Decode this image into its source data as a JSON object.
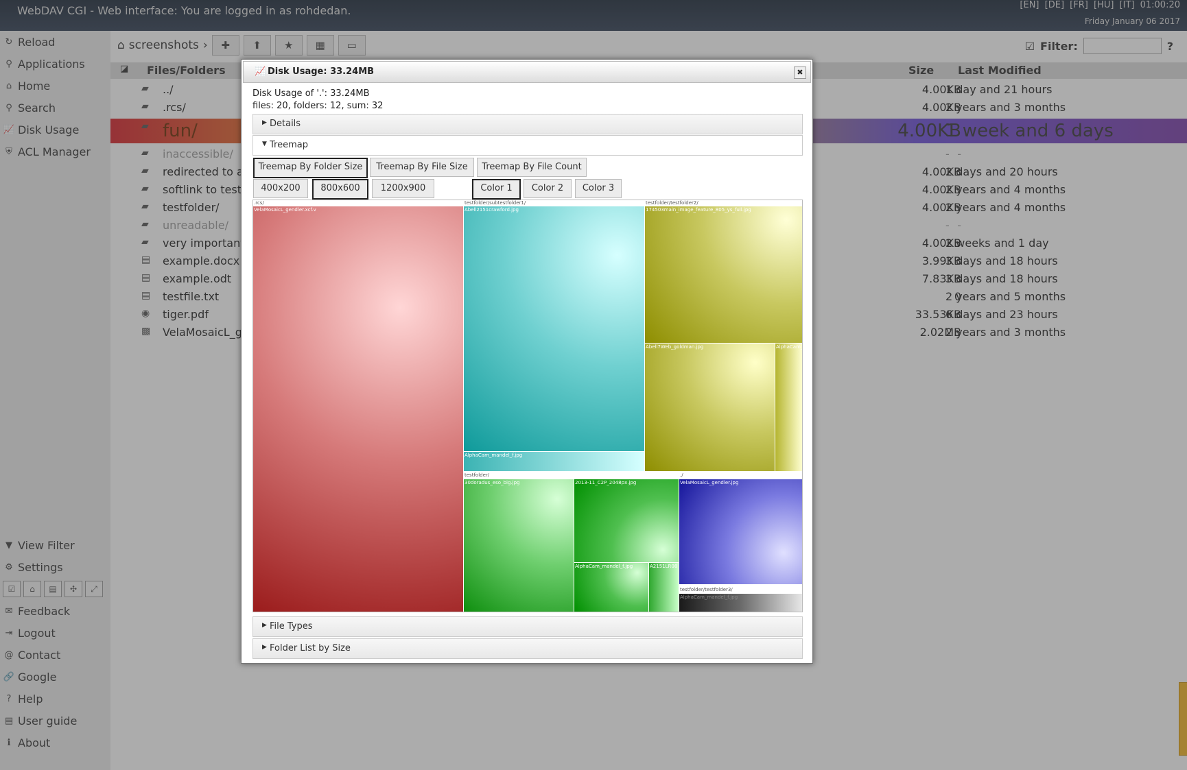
{
  "app": {
    "title": "WebDAV CGI - Web interface: You are logged in as rohdedan.",
    "languages": [
      "[EN]",
      "[DE]",
      "[FR]",
      "[HU]",
      "[IT]"
    ],
    "time": "01:00:20",
    "date": "Friday January 06 2017"
  },
  "sidebar": {
    "items": [
      {
        "label": "Reload",
        "icon": "reload-icon",
        "glyph": "↻"
      },
      {
        "label": "Applications",
        "icon": "applications-icon",
        "glyph": "⚲"
      },
      {
        "label": "Home",
        "icon": "home-icon",
        "glyph": "⌂"
      },
      {
        "label": "Search",
        "icon": "search-icon",
        "glyph": "⚲"
      },
      {
        "label": "Disk Usage",
        "icon": "chart-icon",
        "glyph": "📈"
      },
      {
        "label": "ACL Manager",
        "icon": "shield-icon",
        "glyph": "⛨"
      }
    ],
    "bottom_items": [
      {
        "label": "View Filter",
        "icon": "filter-icon",
        "glyph": "▼"
      },
      {
        "label": "Settings",
        "icon": "gear-icon",
        "glyph": "⚙"
      }
    ],
    "footer_items": [
      {
        "label": "Feedback",
        "icon": "feedback-icon",
        "glyph": "✉"
      },
      {
        "label": "Logout",
        "icon": "logout-icon",
        "glyph": "⇥"
      },
      {
        "label": "Contact",
        "icon": "at-icon",
        "glyph": "@"
      },
      {
        "label": "Google",
        "icon": "link-icon",
        "glyph": "🔗"
      },
      {
        "label": "Help",
        "icon": "help-icon",
        "glyph": "?"
      },
      {
        "label": "User guide",
        "icon": "book-icon",
        "glyph": "▤"
      },
      {
        "label": "About",
        "icon": "info-icon",
        "glyph": "ℹ"
      }
    ]
  },
  "toolbar": {
    "breadcrumb": "screenshots",
    "filter_label": "Filter:",
    "filter_value": "",
    "help": "?"
  },
  "table": {
    "headers": {
      "name": "Files/Folders",
      "size": "Size",
      "modified": "Last Modified"
    },
    "rows": [
      {
        "name": "../",
        "size": "4.00KB",
        "modified": "1 day and 21 hours",
        "icon": "folder-up-icon"
      },
      {
        "name": ".rcs/",
        "size": "4.00KB",
        "modified": "2 years and 3 months",
        "icon": "folder-icon"
      },
      {
        "name": "fun/",
        "size": "4.00KB",
        "modified": "1 week and 6 days",
        "icon": "folder-icon"
      },
      {
        "name": "inaccessible/",
        "size": "-",
        "modified": "-",
        "icon": "folder-icon"
      },
      {
        "name": "redirected to a",
        "size": "4.00KB",
        "modified": "2 days and 20 hours",
        "icon": "folder-link-icon"
      },
      {
        "name": "softlink to testf",
        "size": "4.00KB",
        "modified": "2 years and 4 months",
        "icon": "folder-link-icon"
      },
      {
        "name": "testfolder/",
        "size": "4.00KB",
        "modified": "2 years and 4 months",
        "icon": "folder-icon"
      },
      {
        "name": "unreadable/",
        "size": "-",
        "modified": "-",
        "icon": "folder-icon"
      },
      {
        "name": "very important",
        "size": "4.00KB",
        "modified": "2 weeks and 1 day",
        "icon": "folder-icon"
      },
      {
        "name": "example.docx",
        "size": "3.99KB",
        "modified": "3 days and 18 hours",
        "icon": "document-icon"
      },
      {
        "name": "example.odt",
        "size": "7.83KB",
        "modified": "3 days and 18 hours",
        "icon": "document-icon"
      },
      {
        "name": "testfile.txt",
        "size": "0",
        "modified": "2 years and 5 months",
        "icon": "text-file-icon"
      },
      {
        "name": "tiger.pdf",
        "size": "33.53KB",
        "modified": "6 days and 23 hours",
        "icon": "pdf-icon"
      },
      {
        "name": "VelaMosaicL_ge",
        "size": "2.02MB",
        "modified": "2 years and 3 months",
        "icon": "image-icon"
      }
    ]
  },
  "dialog": {
    "title": "Disk Usage: 33.24MB",
    "summary": "Disk Usage of '.': 33.24MB",
    "counts": "files: 20, folders: 12, sum: 32",
    "sections": {
      "details": "Details",
      "treemap": "Treemap",
      "file_types": "File Types",
      "folder_list": "Folder List by Size"
    },
    "treemap_modes": [
      "Treemap By Folder Size",
      "Treemap By File Size",
      "Treemap By File Count"
    ],
    "sizes": [
      "400x200",
      "800x600",
      "1200x900"
    ],
    "colors": [
      "Color 1",
      "Color 2",
      "Color 3"
    ],
    "selected_mode": "Treemap By Folder Size",
    "selected_size": "800x600",
    "selected_color": "Color 1"
  },
  "treemap": {
    "groups": [
      ".rcs/",
      "testfolder/subtestfolder1/",
      "testfolder/testfolder2/",
      "testfolder/",
      "./",
      "testfolder/testfolder3/"
    ],
    "files": [
      "VelaMosaicL_gendler.xcf.v",
      "Abell2151crawford.jpg",
      "AlphaCam_mandel_f.jpg",
      "174503main_image_feature_805_ys_full.jpg",
      "Abell7Web_goldman.jpg",
      "AlphaCam_",
      "30doradus_eso_big.jpg",
      "2013-11_C2P_2048px.jpg",
      "AlphaCam_mandel_f.jpg",
      "A2151LR08",
      "VelaMosaicL_gendler.jpg",
      "AlphaCam_mandel_f.jpg"
    ]
  }
}
